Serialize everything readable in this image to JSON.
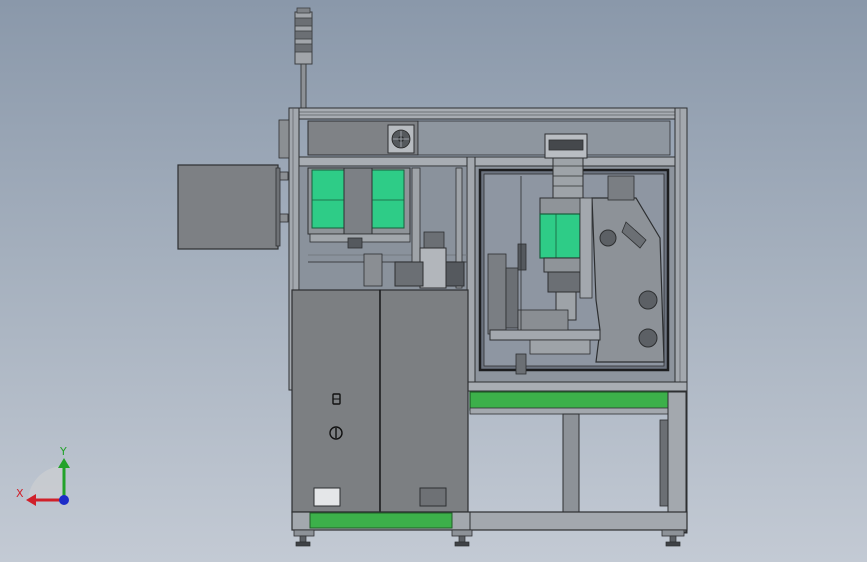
{
  "viewport": {
    "background_top": "#8a98aa",
    "background_bottom": "#c3cad4"
  },
  "model": {
    "frame_color": "#9aa0a6",
    "panel_color": "#7c7f82",
    "accent_green": "#2ecc87",
    "base_green": "#3cb04a",
    "window_glass": "#6d7480"
  },
  "triad": {
    "x_label": "X",
    "y_label": "Y",
    "x_color": "#d0202a",
    "y_color": "#22a22a",
    "z_color": "#1c2cc8",
    "icon": "coordinate-triad-icon"
  }
}
